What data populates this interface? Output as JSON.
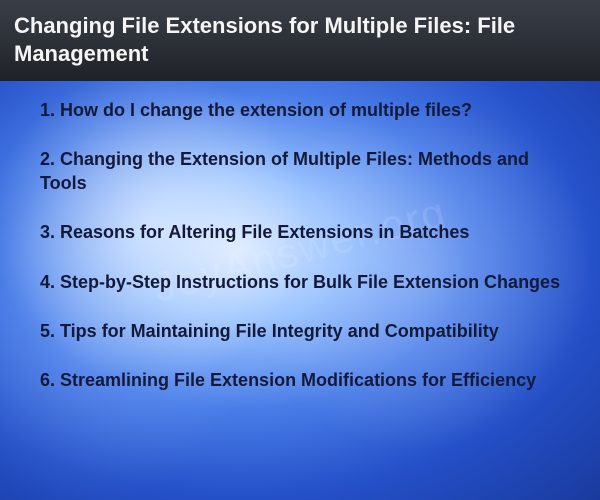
{
  "header": {
    "title": "Changing File Extensions for Multiple Files: File Management"
  },
  "watermark": "JoyAnswer.org",
  "list": {
    "items": [
      "1. How do I change the extension of multiple files?",
      "2. Changing the Extension of Multiple Files: Methods and Tools",
      "3. Reasons for Altering File Extensions in Batches",
      "4. Step-by-Step Instructions for Bulk File Extension Changes",
      "5. Tips for Maintaining File Integrity and Compatibility",
      "6. Streamlining File Extension Modifications for Efficiency"
    ]
  }
}
